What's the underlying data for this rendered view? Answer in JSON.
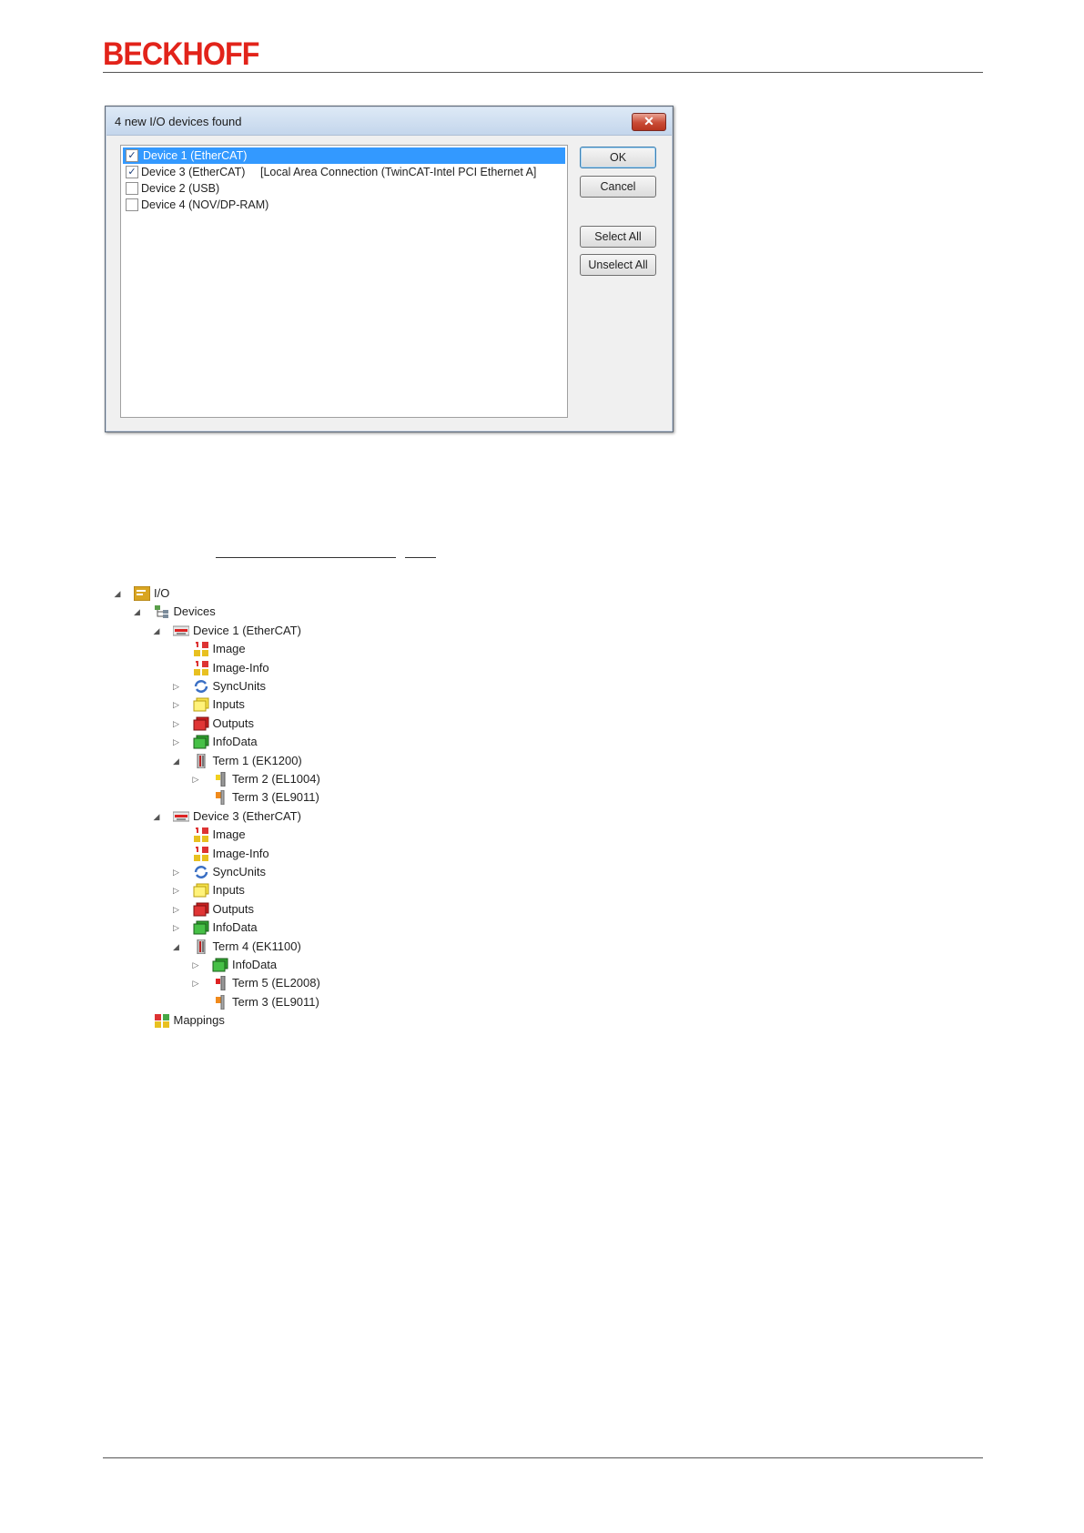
{
  "header": {
    "logo_text": "BECKHOFF"
  },
  "dialog": {
    "title": "4 new I/O devices found",
    "close_glyph": "✕",
    "devices": [
      {
        "label": "Device 1 (EtherCAT)",
        "checked": true,
        "selected": true,
        "connection": ""
      },
      {
        "label": "Device 3 (EtherCAT)",
        "checked": true,
        "selected": false,
        "connection": "[Local Area Connection (TwinCAT-Intel PCI Ethernet A]"
      },
      {
        "label": "Device 2 (USB)",
        "checked": false,
        "selected": false,
        "connection": ""
      },
      {
        "label": "Device 4 (NOV/DP-RAM)",
        "checked": false,
        "selected": false,
        "connection": ""
      }
    ],
    "buttons": {
      "ok": "OK",
      "cancel": "Cancel",
      "select_all": "Select All",
      "unselect_all": "Unselect All"
    }
  },
  "tree": [
    {
      "label": "I/O",
      "level": 0,
      "expander": "expanded",
      "icon": "io-folder-icon"
    },
    {
      "label": "Devices",
      "level": 1,
      "expander": "expanded",
      "icon": "devices-icon"
    },
    {
      "label": "Device 1 (EtherCAT)",
      "level": 2,
      "expander": "expanded",
      "icon": "ethercat-device-icon"
    },
    {
      "label": "Image",
      "level": 3,
      "expander": "none",
      "icon": "image-icon"
    },
    {
      "label": "Image-Info",
      "level": 3,
      "expander": "none",
      "icon": "image-info-icon"
    },
    {
      "label": "SyncUnits",
      "level": 3,
      "expander": "collapsed",
      "icon": "syncunits-icon"
    },
    {
      "label": "Inputs",
      "level": 3,
      "expander": "collapsed",
      "icon": "inputs-icon"
    },
    {
      "label": "Outputs",
      "level": 3,
      "expander": "collapsed",
      "icon": "outputs-icon"
    },
    {
      "label": "InfoData",
      "level": 3,
      "expander": "collapsed",
      "icon": "infodata-icon"
    },
    {
      "label": "Term 1 (EK1200)",
      "level": 3,
      "expander": "expanded",
      "icon": "coupler-icon"
    },
    {
      "label": "Term 2 (EL1004)",
      "level": 4,
      "expander": "collapsed",
      "icon": "input-terminal-icon"
    },
    {
      "label": "Term 3 (EL9011)",
      "level": 4,
      "expander": "none",
      "icon": "end-terminal-icon"
    },
    {
      "label": "Device 3 (EtherCAT)",
      "level": 2,
      "expander": "expanded",
      "icon": "ethercat-device-icon"
    },
    {
      "label": "Image",
      "level": 3,
      "expander": "none",
      "icon": "image-icon"
    },
    {
      "label": "Image-Info",
      "level": 3,
      "expander": "none",
      "icon": "image-info-icon"
    },
    {
      "label": "SyncUnits",
      "level": 3,
      "expander": "collapsed",
      "icon": "syncunits-icon"
    },
    {
      "label": "Inputs",
      "level": 3,
      "expander": "collapsed",
      "icon": "inputs-icon"
    },
    {
      "label": "Outputs",
      "level": 3,
      "expander": "collapsed",
      "icon": "outputs-icon"
    },
    {
      "label": "InfoData",
      "level": 3,
      "expander": "collapsed",
      "icon": "infodata-icon"
    },
    {
      "label": "Term 4 (EK1100)",
      "level": 3,
      "expander": "expanded",
      "icon": "coupler-icon"
    },
    {
      "label": "InfoData",
      "level": 4,
      "expander": "collapsed",
      "icon": "infodata-icon"
    },
    {
      "label": "Term 5 (EL2008)",
      "level": 4,
      "expander": "collapsed",
      "icon": "output-terminal-icon"
    },
    {
      "label": "Term 3 (EL9011)",
      "level": 4,
      "expander": "none",
      "icon": "end-terminal-icon"
    },
    {
      "label": "Mappings",
      "level": 1,
      "expander": "none",
      "icon": "mappings-icon"
    }
  ],
  "colors": {
    "brand": "#e2231a",
    "selection": "#3399ff"
  }
}
